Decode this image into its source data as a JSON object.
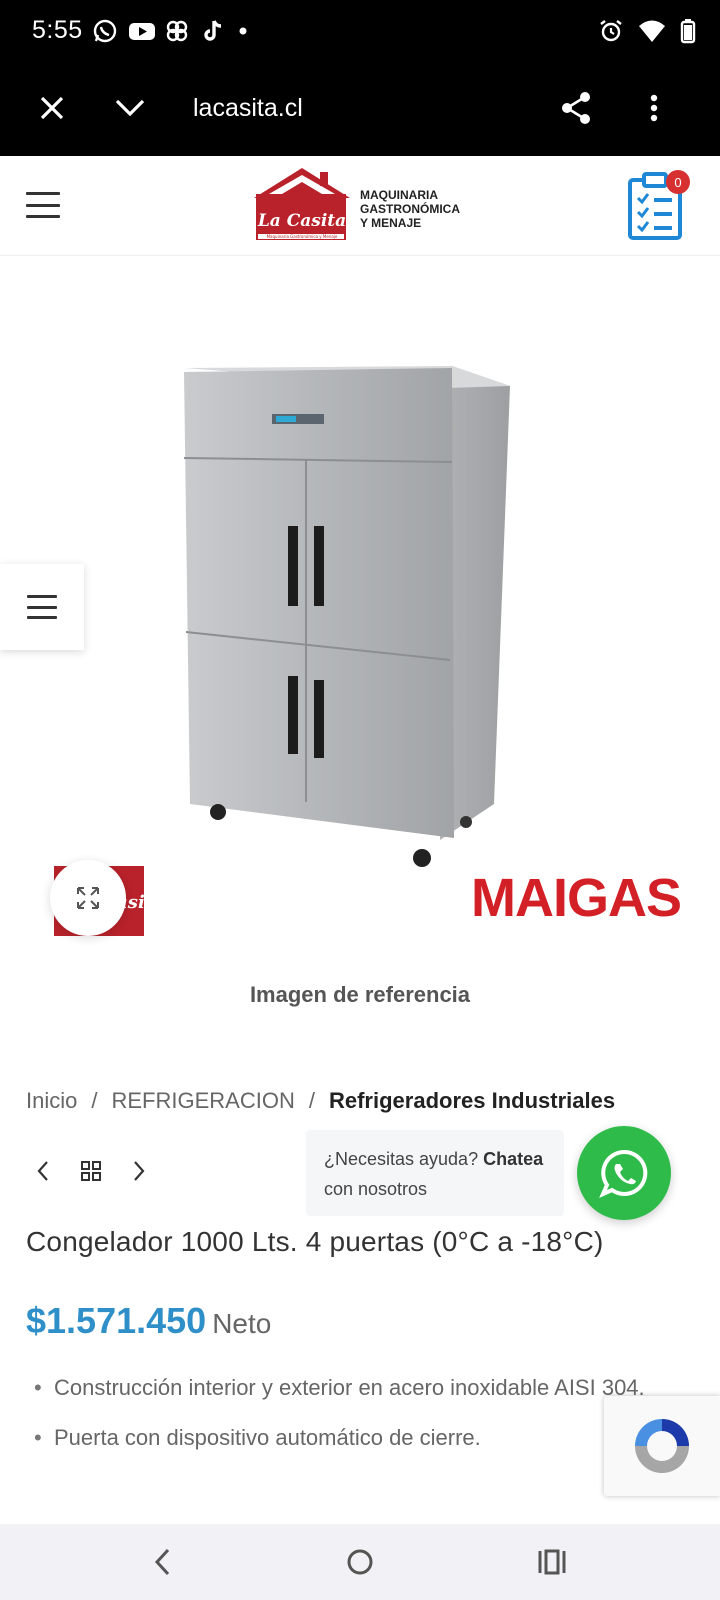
{
  "status_bar": {
    "time": "5:55",
    "notification_icons": [
      "whatsapp-icon",
      "youtube-icon",
      "pinwheel-icon",
      "tiktok-icon",
      "dot-icon"
    ],
    "system_icons": [
      "alarm-icon",
      "wifi-icon",
      "battery-icon"
    ]
  },
  "browser": {
    "url": "lacasita.cl"
  },
  "header": {
    "logo_text": "La Casita",
    "logo_subtext": "Maquinaria Gastronómica y Menaje",
    "tagline": "MAQUINARIA\nGASTRONÓMICA\nY MENAJE",
    "cart_count": "0"
  },
  "gallery": {
    "brand_logo": "MAIGAS",
    "watermark_logo": "La Casita",
    "caption": "Imagen de referencia"
  },
  "breadcrumb": {
    "items": [
      "Inicio",
      "REFRIGERACION",
      "Refrigeradores Industriales"
    ],
    "separator": "/"
  },
  "chat": {
    "prefix": "¿Necesitas ayuda? ",
    "bold": "Chatea",
    "suffix": "con nosotros"
  },
  "product": {
    "title": "Congelador 1000 Lts. 4 puertas (0°C a -18°C)",
    "price": "$1.571.450",
    "price_suffix": "Neto",
    "features": [
      "Construcción interior y exterior en acero inoxidable AISI 304.",
      "Puerta con dispositivo automático de cierre."
    ]
  },
  "colors": {
    "price": "#2f8fc9",
    "logo_red": "#b9222a",
    "whatsapp_green": "#2fbb4a",
    "badge_red": "#d63031"
  }
}
